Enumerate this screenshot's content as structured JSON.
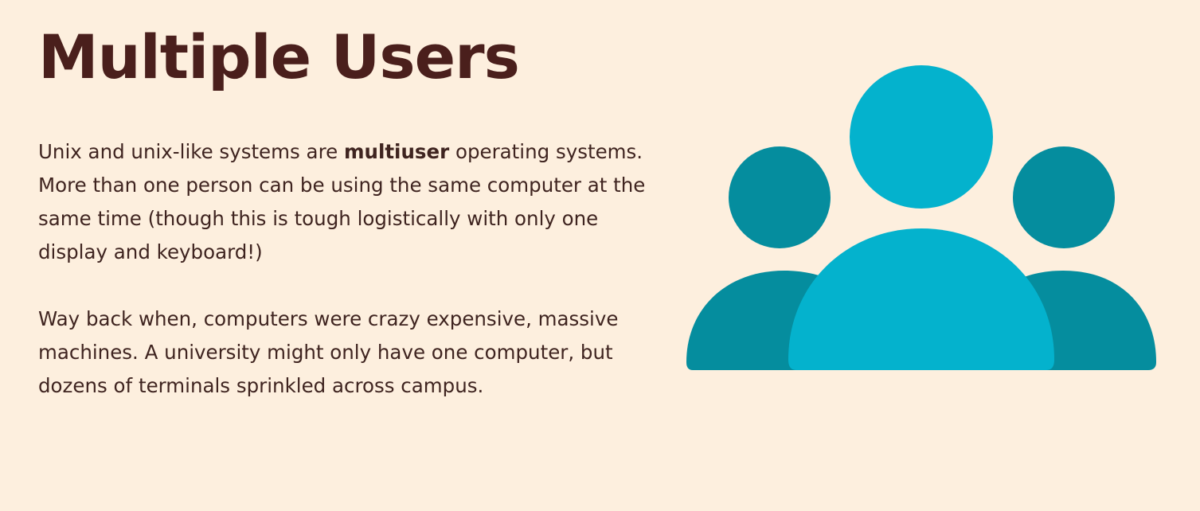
{
  "slide": {
    "title": "Multiple Users",
    "paragraph1": {
      "before_bold": "Unix and unix-like systems are ",
      "bold": "multiuser",
      "after_bold": " operating systems.  More than one person can be using the same computer at the same time (though this is tough logistically with only one display and keyboard!)"
    },
    "paragraph2": "Way back when, computers were crazy expensive, massive machines.  A university might only have one computer, but dozens of terminals sprinkled across campus."
  },
  "colors": {
    "background": "#fdefde",
    "title": "#4a1f1c",
    "text": "#3f2420",
    "user_primary": "#04b2cd",
    "user_secondary": "#058d9e"
  },
  "icons": {
    "illustration": "users-group-icon"
  }
}
